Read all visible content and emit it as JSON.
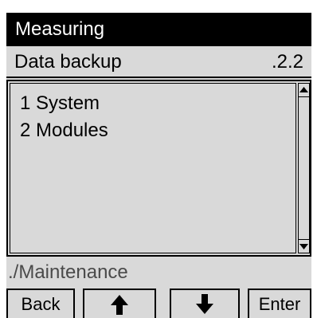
{
  "title_bar": {
    "text": "Measuring"
  },
  "menu": {
    "title": "Data backup",
    "code": ".2.2"
  },
  "items": [
    {
      "label": "1 System"
    },
    {
      "label": "2 Modules"
    }
  ],
  "path": "./Maintenance",
  "softkeys": {
    "back": "Back",
    "up_icon": "arrow-up-icon",
    "down_icon": "arrow-down-icon",
    "enter": "Enter"
  },
  "colors": {
    "screen_bg": "#d9d9d9",
    "title_bg": "#000000",
    "title_fg": "#ffffff",
    "path_fg": "#4a4a4a"
  }
}
